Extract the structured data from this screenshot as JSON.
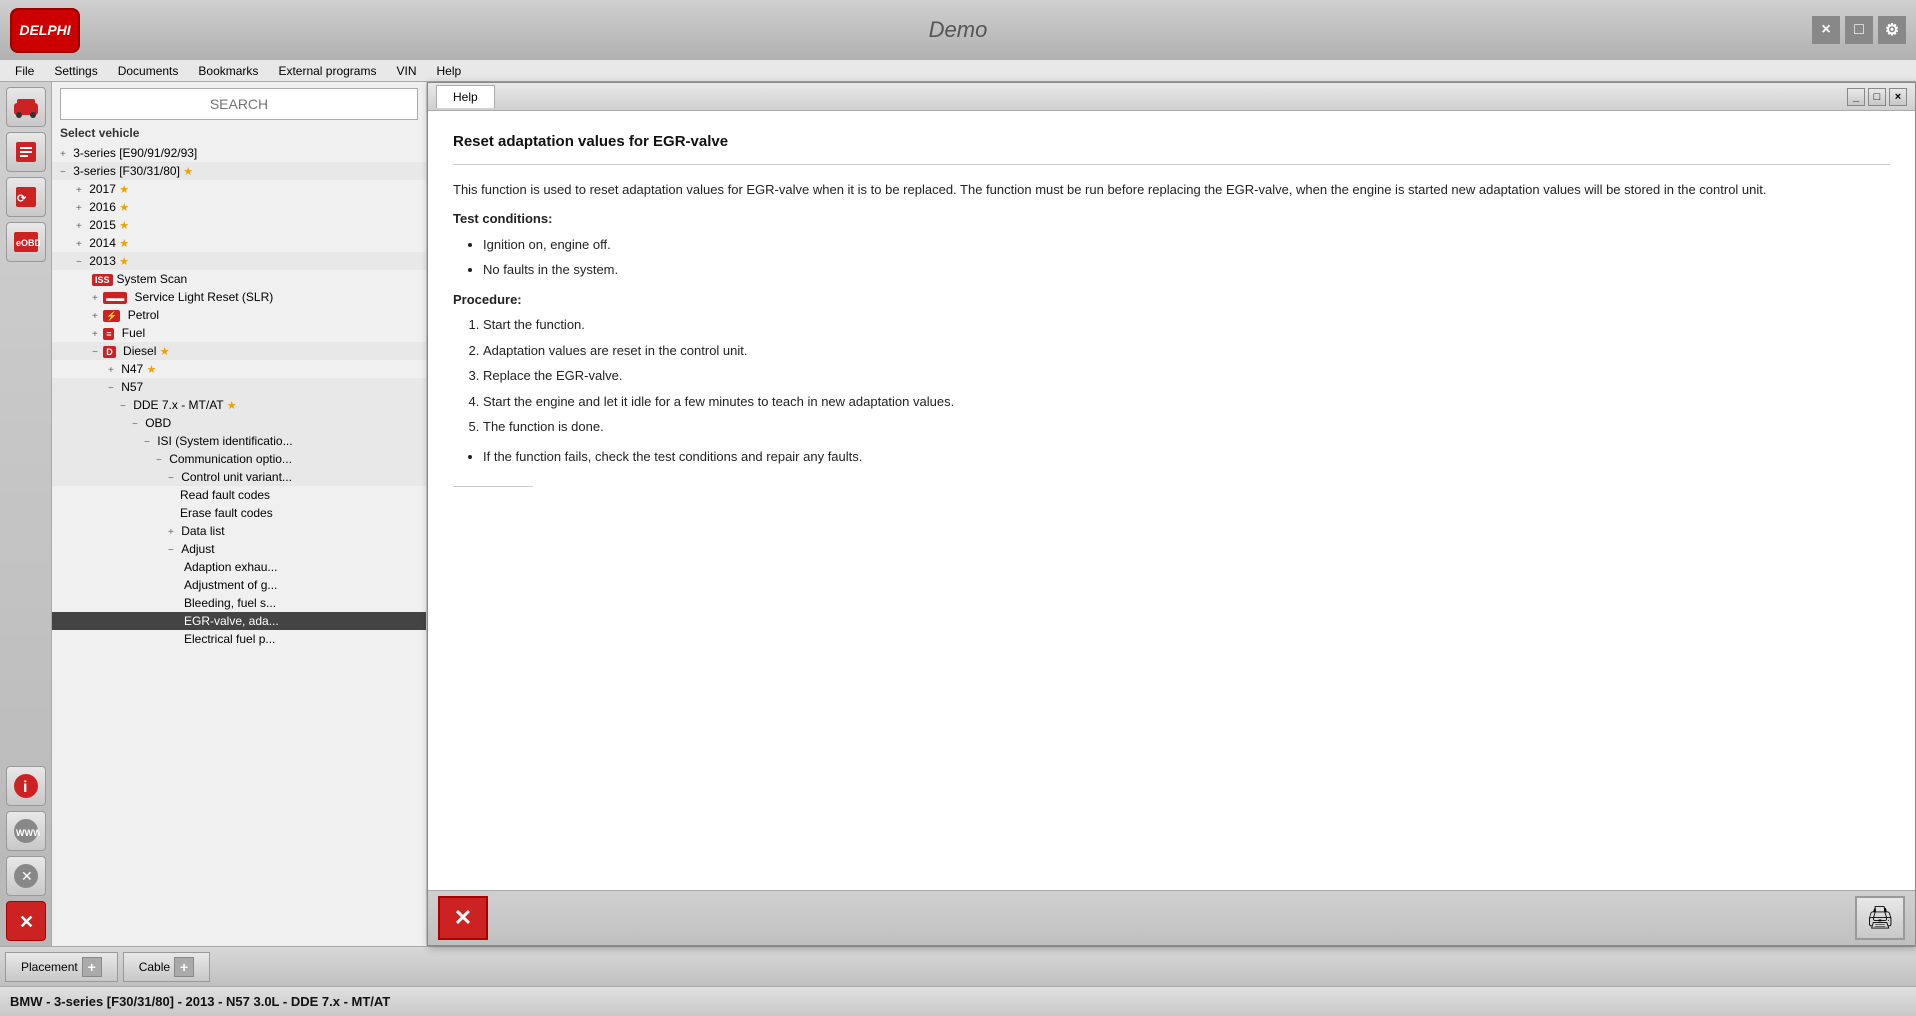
{
  "app": {
    "title": "Demo",
    "logo": "DELPHI",
    "close_label": "×",
    "minimize_label": "—",
    "maximize_label": "□"
  },
  "menu": {
    "items": [
      "File",
      "Settings",
      "Documents",
      "Bookmarks",
      "External programs",
      "VIN",
      "Help"
    ]
  },
  "sidebar": {
    "search_placeholder": "SEARCH",
    "select_vehicle_label": "Select vehicle",
    "tree": [
      {
        "id": "3series-e90",
        "label": "3-series [E90/91/92/93]",
        "level": 0,
        "expanded": false,
        "prefix": "+"
      },
      {
        "id": "3series-f30",
        "label": "3-series [F30/31/80]",
        "level": 0,
        "expanded": true,
        "prefix": "−",
        "star": true
      },
      {
        "id": "2017",
        "label": "2017",
        "level": 1,
        "prefix": "+",
        "star": true
      },
      {
        "id": "2016",
        "label": "2016",
        "level": 1,
        "prefix": "+",
        "star": true
      },
      {
        "id": "2015",
        "label": "2015",
        "level": 1,
        "prefix": "+",
        "star": true
      },
      {
        "id": "2014",
        "label": "2014",
        "level": 1,
        "prefix": "+",
        "star": true
      },
      {
        "id": "2013",
        "label": "2013",
        "level": 1,
        "expanded": true,
        "prefix": "−",
        "star": true
      },
      {
        "id": "system-scan",
        "label": "System Scan",
        "level": 2,
        "badge": "ISS"
      },
      {
        "id": "service-light",
        "label": "Service Light Reset (SLR)",
        "level": 2,
        "prefix": "+",
        "badge": "SLR"
      },
      {
        "id": "petrol",
        "label": "Petrol",
        "level": 2,
        "prefix": "+",
        "badge": "P"
      },
      {
        "id": "fuel",
        "label": "Fuel",
        "level": 2,
        "prefix": "+",
        "badge": "F"
      },
      {
        "id": "diesel",
        "label": "Diesel",
        "level": 2,
        "expanded": true,
        "prefix": "−",
        "badge": "D",
        "star": true
      },
      {
        "id": "n47",
        "label": "N47",
        "level": 3,
        "prefix": "+",
        "star": true
      },
      {
        "id": "n57",
        "label": "N57",
        "level": 3,
        "expanded": true,
        "prefix": "−"
      },
      {
        "id": "dde7x",
        "label": "DDE 7.x - MT/AT",
        "level": 4,
        "expanded": true,
        "prefix": "−",
        "star": true
      },
      {
        "id": "obd",
        "label": "OBD",
        "level": 5,
        "expanded": true,
        "prefix": "−"
      },
      {
        "id": "isi",
        "label": "ISI (System identificatio...",
        "level": 6,
        "expanded": true,
        "prefix": "−"
      },
      {
        "id": "comm-options",
        "label": "Communication optio...",
        "level": 7,
        "expanded": true,
        "prefix": "−"
      },
      {
        "id": "ctrl-unit",
        "label": "Control unit variant...",
        "level": 8,
        "expanded": true,
        "prefix": "−"
      },
      {
        "id": "read-fault",
        "label": "Read fault codes",
        "level": 9
      },
      {
        "id": "erase-fault",
        "label": "Erase fault codes",
        "level": 9
      },
      {
        "id": "data-list",
        "label": "Data list",
        "level": 8,
        "prefix": "+"
      },
      {
        "id": "adjust",
        "label": "Adjust",
        "level": 8,
        "expanded": true,
        "prefix": "−"
      },
      {
        "id": "adaption-exhaust",
        "label": "Adaption exhau...",
        "level": 9
      },
      {
        "id": "adjustment-of-g",
        "label": "Adjustment of g...",
        "level": 9
      },
      {
        "id": "bleeding-fuel",
        "label": "Bleeding, fuel s...",
        "level": 9
      },
      {
        "id": "egr-valve",
        "label": "EGR-valve, ada...",
        "level": 9,
        "selected": true
      },
      {
        "id": "electrical-fuel",
        "label": "Electrical fuel p...",
        "level": 9
      }
    ]
  },
  "icon_sidebar": {
    "icons": [
      {
        "id": "car-icon",
        "symbol": "🚗"
      },
      {
        "id": "scan-icon",
        "symbol": "📡"
      },
      {
        "id": "service-icon",
        "symbol": "🔧"
      },
      {
        "id": "eobd-icon",
        "symbol": "OBD"
      },
      {
        "id": "info-icon",
        "symbol": "ℹ"
      },
      {
        "id": "www-icon",
        "symbol": "WWW"
      },
      {
        "id": "settings-icon",
        "symbol": "⚙"
      },
      {
        "id": "close-icon",
        "symbol": "✕"
      }
    ]
  },
  "help": {
    "tab_label": "Help",
    "title": "Reset adaptation values for EGR-valve",
    "intro": "This function is used to reset adaptation values for EGR-valve when it is to be replaced. The function must be run before replacing the EGR-valve, when the engine is started new adaptation values will be stored in the control unit.",
    "test_conditions_label": "Test conditions:",
    "test_conditions": [
      "Ignition on, engine off.",
      "No faults in the system."
    ],
    "procedure_label": "Procedure:",
    "procedure_steps": [
      "Start the function.",
      "Adaptation values are reset in the control unit.",
      "Replace the EGR-valve.",
      "Start the engine and let it idle for a few minutes to teach in new adaptation values.",
      "The function is done."
    ],
    "note": "If the function fails, check the test conditions and repair any faults.",
    "close_label": "✕",
    "print_label": "🖨"
  },
  "bottom_bar": {
    "placement_label": "Placement",
    "cable_label": "Cable"
  },
  "status_bar": {
    "text": "BMW - 3-series [F30/31/80] - 2013 - N57 3.0L - DDE 7.x - MT/AT"
  }
}
